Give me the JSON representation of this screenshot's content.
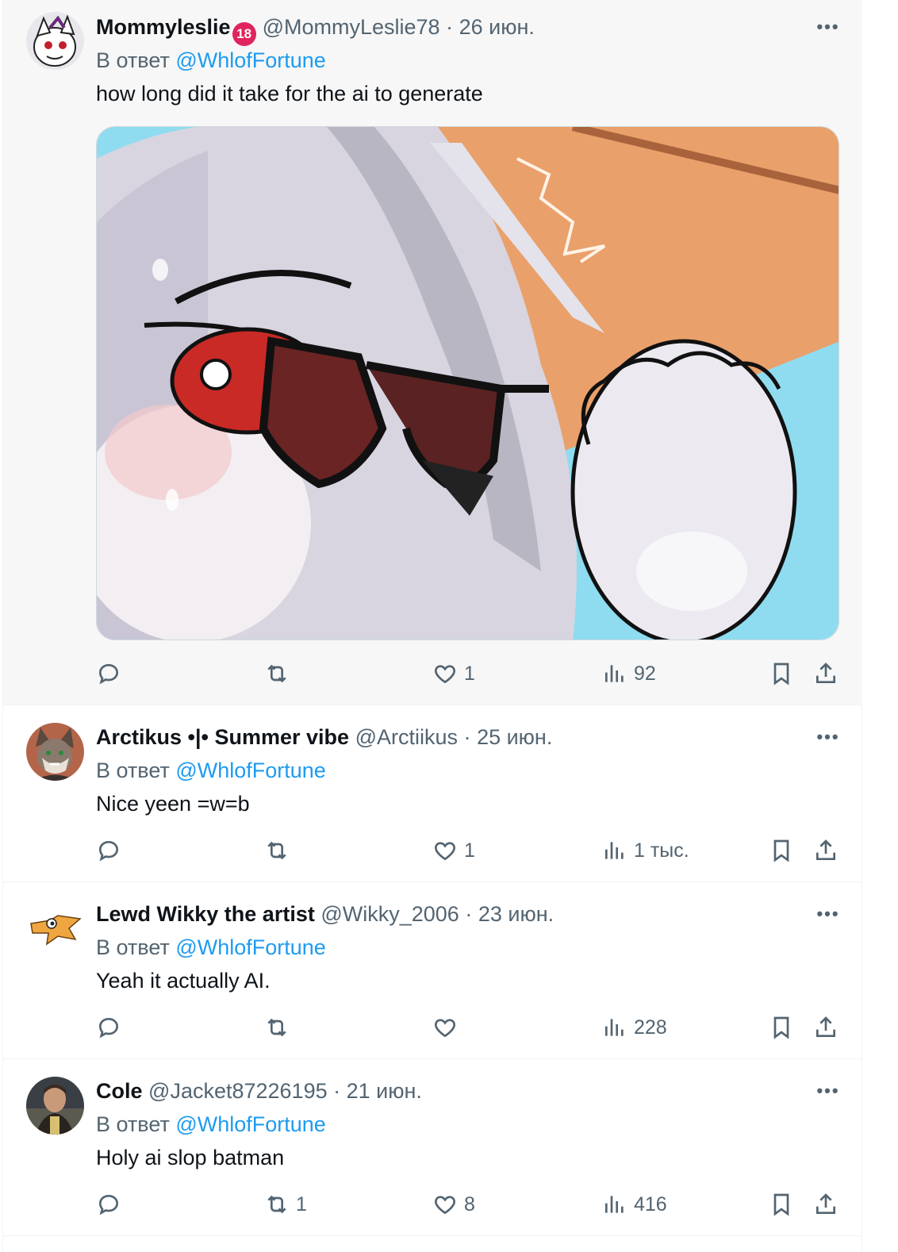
{
  "tweets": [
    {
      "name": "Mommyleslie",
      "badge": "18",
      "handle": "@MommyLeslie78",
      "dot": "·",
      "date": "26 июн.",
      "reply_prefix": "В ответ",
      "reply_to": "@WhlofFortune",
      "text": "how long did it take for the ai to generate",
      "replies": "",
      "retweets": "",
      "likes": "1",
      "views": "92"
    },
    {
      "name": "Arctikus •|• Summer vibe",
      "handle": "@Arctiikus",
      "dot": "·",
      "date": "25 июн.",
      "reply_prefix": "В ответ",
      "reply_to": "@WhlofFortune",
      "text": "Nice yeen =w=b",
      "replies": "",
      "retweets": "",
      "likes": "1",
      "views": "1 тыс."
    },
    {
      "name": "Lewd Wikky the artist",
      "handle": "@Wikky_2006",
      "dot": "·",
      "date": "23 июн.",
      "reply_prefix": "В ответ",
      "reply_to": "@WhlofFortune",
      "text": "Yeah it actually AI.",
      "replies": "",
      "retweets": "",
      "likes": "",
      "views": "228"
    },
    {
      "name": "Cole",
      "handle": "@Jacket87226195",
      "dot": "·",
      "date": "21 июн.",
      "reply_prefix": "В ответ",
      "reply_to": "@WhlofFortune",
      "text": "Holy ai slop batman",
      "replies": "",
      "retweets": "1",
      "likes": "8",
      "views": "416"
    }
  ],
  "more_glyph": "•••",
  "icons": [
    "reply-icon",
    "retweet-icon",
    "like-icon",
    "views-icon",
    "bookmark-icon",
    "share-icon",
    "more-icon"
  ],
  "colors": {
    "accent": "#1d9bf0",
    "muted": "#536471",
    "text": "#0f1419",
    "highlight_bg": "#f7f7f7",
    "badge": "#e0245e"
  }
}
